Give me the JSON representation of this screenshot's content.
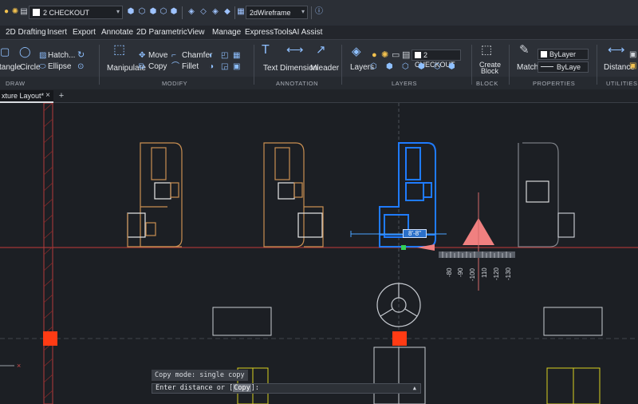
{
  "quick_access": {
    "current_layer": "2 CHECKOUT",
    "visual_style": "2dWireframe"
  },
  "menu": [
    "2D Drafting",
    "Insert",
    "Export",
    "Annotate",
    "2D Parametric",
    "View",
    "Manage",
    "ExpressTools",
    "AI Assist"
  ],
  "ribbon": {
    "draw": {
      "rectangle": "tangle",
      "circle": "Circle",
      "hatch": "Hatch...",
      "ellipse": "Ellipse",
      "panel": "DRAW"
    },
    "modify": {
      "manipulate": "Manipulate",
      "move": "Move",
      "copy": "Copy",
      "chamfer": "Chamfer",
      "fillet": "Fillet",
      "panel": "MODIFY"
    },
    "annotation": {
      "text": "Text",
      "dimension": "Dimension",
      "mleader": "Mleader",
      "panel": "ANNOTATION"
    },
    "layers": {
      "layers": "Layers",
      "layer_combo": "2 CHECKOUT",
      "panel": "LAYERS"
    },
    "block": {
      "create_line1": "Create",
      "create_line2": "Block",
      "panel": "BLOCK"
    },
    "properties": {
      "match": "Match",
      "color": "ByLayer",
      "linetype": "ByLaye",
      "panel": "PROPERTIES"
    },
    "utilities": {
      "distance": "Distance",
      "panel": "UTILITIES"
    }
  },
  "tabs": {
    "active": "xture Layout*",
    "close": "×",
    "add": "+"
  },
  "canvas": {
    "dimension_input": "8'-8\"",
    "ruler_labels": [
      "-80",
      "-90",
      "-100",
      "110",
      "-120",
      "-130"
    ],
    "colors": {
      "selection": "#1f7bff",
      "fixture": "#c98f52",
      "marker": "#ff3b14",
      "triangle": "#f08080",
      "accent_line": "#a33636"
    }
  },
  "command": {
    "history": "Copy mode: single copy",
    "prompt_pre": "Enter distance or [",
    "prompt_kw": "Copy",
    "prompt_post": "]:",
    "scroll": "▲"
  }
}
